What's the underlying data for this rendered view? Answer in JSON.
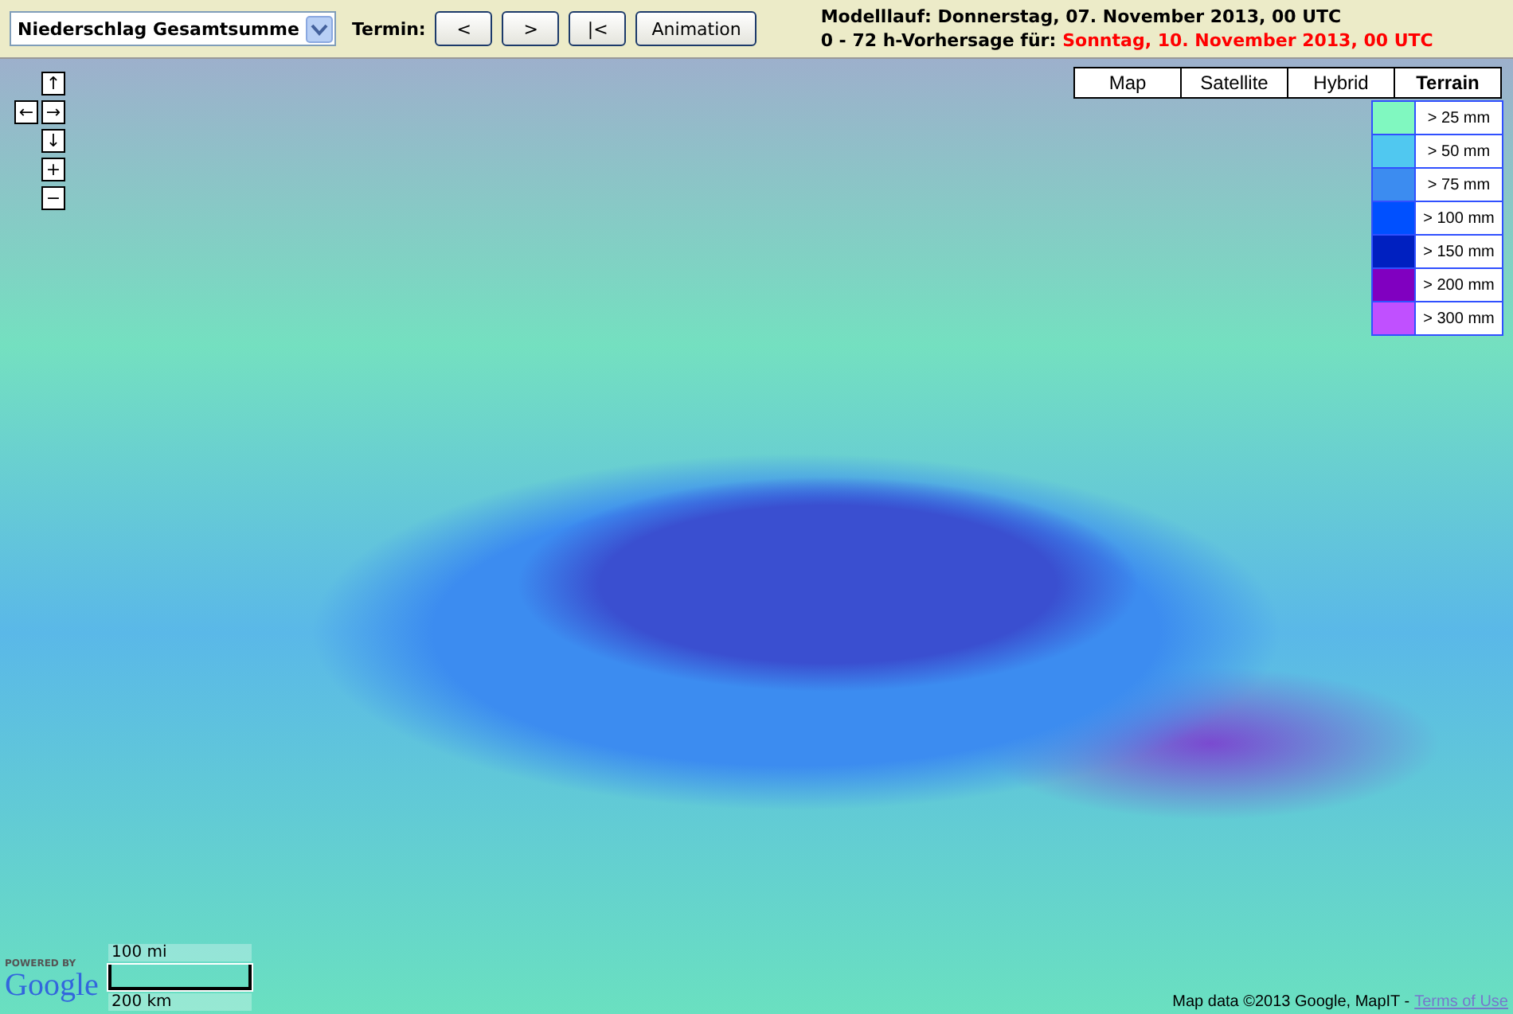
{
  "toolbar": {
    "variable_select": {
      "value": "Niederschlag Gesamtsumme"
    },
    "termin_label": "Termin:",
    "buttons": [
      "<",
      ">",
      "|<",
      "Animation"
    ],
    "model_run": "Modelllauf: Donnerstag, 07. November 2013, 00 UTC",
    "forecast_label": "0 - 72 h-Vorhersage für:",
    "forecast_date": "Sonntag, 10. November 2013, 00 UTC"
  },
  "map": {
    "nav_buttons": [
      "↑",
      "←",
      "→",
      "↓",
      "+",
      "−"
    ],
    "map_types": [
      {
        "label": "Map",
        "selected": false
      },
      {
        "label": "Satellite",
        "selected": false
      },
      {
        "label": "Hybrid",
        "selected": false
      },
      {
        "label": "Terrain",
        "selected": true
      }
    ],
    "legend": [
      {
        "label": "> 25 mm",
        "color": "#80f8c0"
      },
      {
        "label": "> 50 mm",
        "color": "#50c8f0"
      },
      {
        "label": "> 75 mm",
        "color": "#3c8cf0"
      },
      {
        "label": "> 100 mm",
        "color": "#0050ff"
      },
      {
        "label": "> 150 mm",
        "color": "#0020c0"
      },
      {
        "label": "> 200 mm",
        "color": "#8000c0"
      },
      {
        "label": "> 300 mm",
        "color": "#c050ff"
      }
    ],
    "logo": {
      "powered_by": "POWERED BY",
      "brand": "Google"
    },
    "scale": [
      "100 mi",
      "200 km"
    ],
    "attribution": "Map data ©2013 Google, MapIT -",
    "terms_link": "Terms of Use"
  }
}
